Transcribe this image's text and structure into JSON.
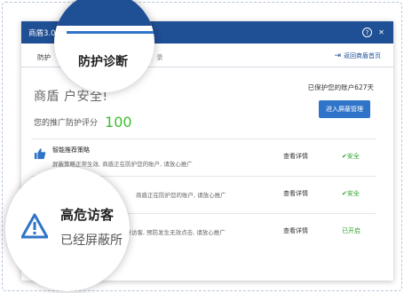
{
  "window": {
    "title": "商盾3.0"
  },
  "tabs": {
    "tab1": "防护",
    "tab3": "录",
    "back": "返回商盾首页"
  },
  "hero": {
    "headline": "商盾       户安全!",
    "score_label": "您的推广防护评分",
    "score": "100"
  },
  "protect": {
    "text": "已保护您的账户627天",
    "manage_button": "进入屏蔽管理"
  },
  "rows": [
    {
      "title": "智能推荐策略",
      "desc": "屏蔽策略正常生效, 商盾正在防护您的账户, 请放心推广",
      "view": "查看详情",
      "status": "✔安全"
    },
    {
      "title": "",
      "desc": "商盾正在防护您的账户, 请放心推广",
      "view": "查看详情",
      "status": "✔安全"
    },
    {
      "title": "",
      "desc": "恶意访客, 预防发生无效点击, 请放心推广",
      "view": "查看详情",
      "status": "已开启"
    }
  ],
  "magnifier1": {
    "label": "防护诊断"
  },
  "magnifier2": {
    "title": "高危访客",
    "subtitle": "已经屏蔽所"
  },
  "colors": {
    "titlebar": "#1f4f95",
    "accent": "#2f74c9",
    "safe": "#28a428",
    "score": "#3cbf2e"
  }
}
